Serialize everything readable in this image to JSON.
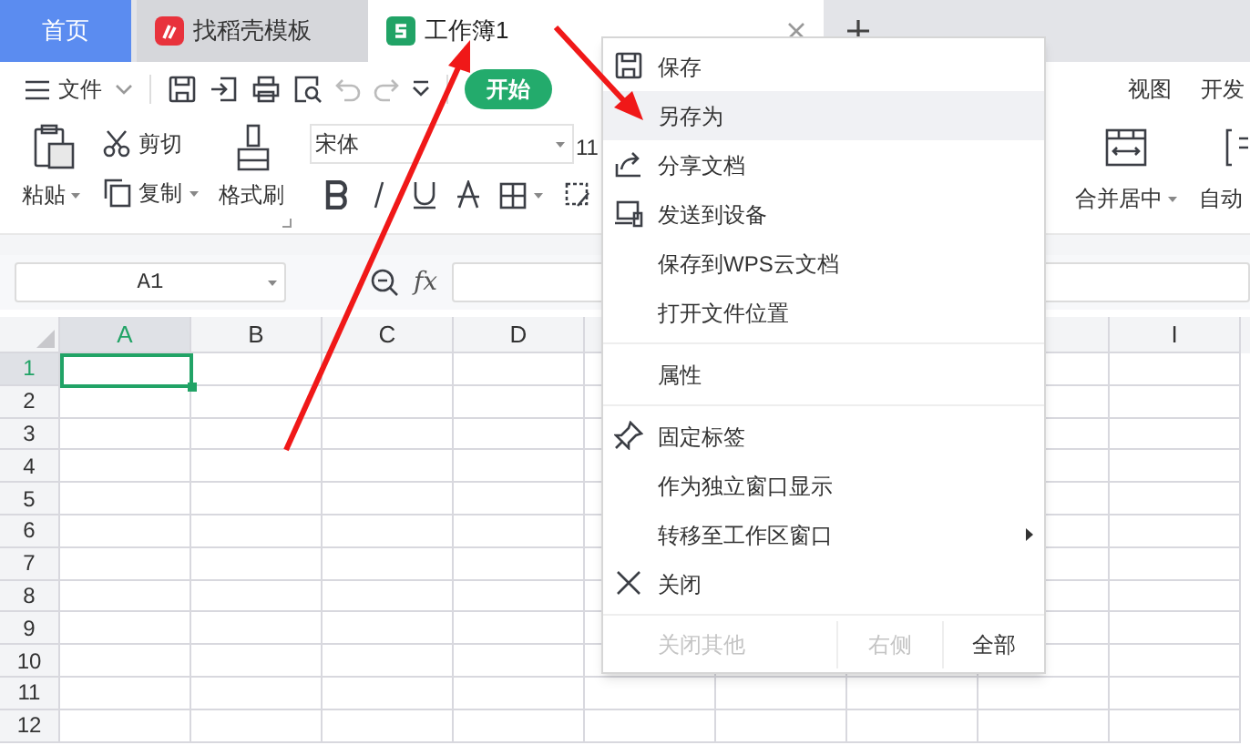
{
  "tabs": [
    {
      "label": "首页",
      "selected": false,
      "kind": "home"
    },
    {
      "label": "找稻壳模板",
      "selected": false,
      "kind": "docer"
    },
    {
      "label": "工作簿1",
      "selected": true,
      "kind": "sheet"
    }
  ],
  "toolbar": {
    "file_menu": "文件",
    "start_button": "开始",
    "ribbon_tabs": [
      "视图",
      "开发"
    ]
  },
  "ribbon": {
    "paste": "粘贴",
    "cut": "剪切",
    "copy": "复制",
    "format_painter": "格式刷",
    "font": "宋体",
    "font_size": "11",
    "merge": "合并居中",
    "wrap": "自动"
  },
  "formula_bar": {
    "cell_name": "A1",
    "fx": "fx"
  },
  "sheet": {
    "columns": [
      {
        "label": "A",
        "selected": true
      },
      {
        "label": "B",
        "selected": false
      },
      {
        "label": "C",
        "selected": false
      },
      {
        "label": "D",
        "selected": false
      },
      {
        "label": "I",
        "selected": false
      }
    ],
    "rows": [
      {
        "label": "1",
        "selected": true
      },
      {
        "label": "2",
        "selected": false
      },
      {
        "label": "3",
        "selected": false
      },
      {
        "label": "4",
        "selected": false
      },
      {
        "label": "5",
        "selected": false
      },
      {
        "label": "6",
        "selected": false
      },
      {
        "label": "7",
        "selected": false
      },
      {
        "label": "8",
        "selected": false
      },
      {
        "label": "9",
        "selected": false
      },
      {
        "label": "10",
        "selected": false
      },
      {
        "label": "11",
        "selected": false
      },
      {
        "label": "12",
        "selected": false
      }
    ]
  },
  "context_menu": {
    "groups": [
      [
        {
          "label": "保存",
          "selected": false,
          "submenu": false
        },
        {
          "label": "另存为",
          "selected": true,
          "submenu": false
        },
        {
          "label": "分享文档",
          "selected": false,
          "submenu": false
        },
        {
          "label": "发送到设备",
          "selected": false,
          "submenu": false
        },
        {
          "label": "保存到WPS云文档",
          "selected": false,
          "submenu": false
        },
        {
          "label": "打开文件位置",
          "selected": false,
          "submenu": false
        }
      ],
      [
        {
          "label": "属性",
          "selected": false,
          "submenu": false
        }
      ],
      [
        {
          "label": "固定标签",
          "selected": false,
          "submenu": false
        },
        {
          "label": "作为独立窗口显示",
          "selected": false,
          "submenu": false
        },
        {
          "label": "转移至工作区窗口",
          "selected": false,
          "submenu": true
        },
        {
          "label": "关闭",
          "selected": false,
          "submenu": false
        }
      ]
    ],
    "footer": [
      {
        "label": "关闭其他",
        "disabled": true
      },
      {
        "label": "右侧",
        "disabled": true
      },
      {
        "label": "全部",
        "disabled": false
      }
    ]
  }
}
